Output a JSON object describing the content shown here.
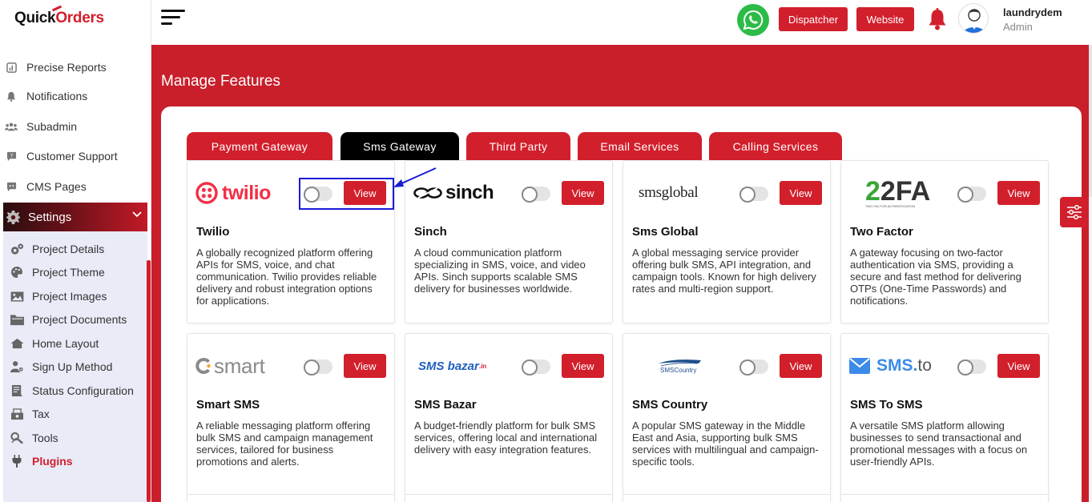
{
  "app": {
    "logo_prefix": "Quick",
    "logo_mark": "O",
    "logo_suffix": "rders"
  },
  "sidebar": {
    "items": [
      {
        "label": "Precise Reports",
        "icon": "chart-icon"
      },
      {
        "label": "Notifications",
        "icon": "bell-icon"
      },
      {
        "label": "Subadmin",
        "icon": "users-icon"
      },
      {
        "label": "Customer Support",
        "icon": "chat-icon"
      },
      {
        "label": "CMS Pages",
        "icon": "comment-icon"
      }
    ],
    "settings_label": "Settings",
    "submenu": [
      {
        "label": "Project Details",
        "icon": "gears-icon"
      },
      {
        "label": "Project Theme",
        "icon": "palette-icon"
      },
      {
        "label": "Project Images",
        "icon": "image-icon"
      },
      {
        "label": "Project Documents",
        "icon": "folder-icon"
      },
      {
        "label": "Home Layout",
        "icon": "home-icon"
      },
      {
        "label": "Sign Up Method",
        "icon": "user-gear-icon"
      },
      {
        "label": "Status Configuration",
        "icon": "document-icon"
      },
      {
        "label": "Tax",
        "icon": "tax-icon"
      },
      {
        "label": "Tools",
        "icon": "tools-icon"
      },
      {
        "label": "Plugins",
        "icon": "plug-icon",
        "active": true
      }
    ]
  },
  "topbar": {
    "dispatcher_label": "Dispatcher",
    "website_label": "Website",
    "username": "laundrydem",
    "role": "Admin"
  },
  "page": {
    "title": "Manage Features"
  },
  "tabs": [
    {
      "label": "Payment Gateway",
      "active": false
    },
    {
      "label": "Sms Gateway",
      "active": true
    },
    {
      "label": "Third Party",
      "active": false
    },
    {
      "label": "Email Services",
      "active": false
    },
    {
      "label": "Calling Services",
      "active": false
    }
  ],
  "cards": [
    {
      "name": "Twilio",
      "logo_text": "twilio",
      "view_label": "View",
      "enabled": false,
      "description": "A globally recognized platform offering APIs for SMS, voice, and chat communication. Twilio provides reliable delivery and robust integration options for applications."
    },
    {
      "name": "Sinch",
      "logo_text": "sinch",
      "view_label": "View",
      "enabled": false,
      "description": "A cloud communication platform specializing in SMS, voice, and video APIs. Sinch supports scalable SMS delivery for businesses worldwide."
    },
    {
      "name": "Sms Global",
      "logo_text": "smsglobal",
      "view_label": "View",
      "enabled": false,
      "description": "A global messaging service provider offering bulk SMS, API integration, and campaign tools. Known for high delivery rates and multi-region support."
    },
    {
      "name": "Two Factor",
      "logo_text": "2FA",
      "logo_subtext": "TWO FACTOR AUTHENTICATION",
      "view_label": "View",
      "enabled": false,
      "description": "A gateway focusing on two-factor authentication via SMS, providing a secure and fast method for delivering OTPs (One-Time Passwords) and notifications."
    },
    {
      "name": "Smart SMS",
      "logo_text": "smart",
      "view_label": "View",
      "enabled": false,
      "description": "A reliable messaging platform offering bulk SMS and campaign management services, tailored for business promotions and alerts."
    },
    {
      "name": "SMS Bazar",
      "logo_text": "SMS bazar",
      "logo_tld": ".in",
      "view_label": "View",
      "enabled": false,
      "description": "A budget-friendly platform for bulk SMS services, offering local and international delivery with easy integration features."
    },
    {
      "name": "SMS Country",
      "logo_text": "SMSCountry",
      "view_label": "View",
      "enabled": false,
      "description": "A popular SMS gateway in the Middle East and Asia, supporting bulk SMS services with multilingual and campaign-specific tools."
    },
    {
      "name": "SMS To SMS",
      "logo_text": "SMS",
      "logo_suffix": "to",
      "view_label": "View",
      "enabled": false,
      "description": "A versatile SMS platform allowing businesses to send transactional and promotional messages with a focus on user-friendly APIs."
    }
  ],
  "colors": {
    "brand_red": "#d21f2c",
    "hero_red": "#c81f2b",
    "active_tab": "#000000",
    "whatsapp_green": "#2dbb48",
    "highlight_blue": "#1b1bd6"
  }
}
